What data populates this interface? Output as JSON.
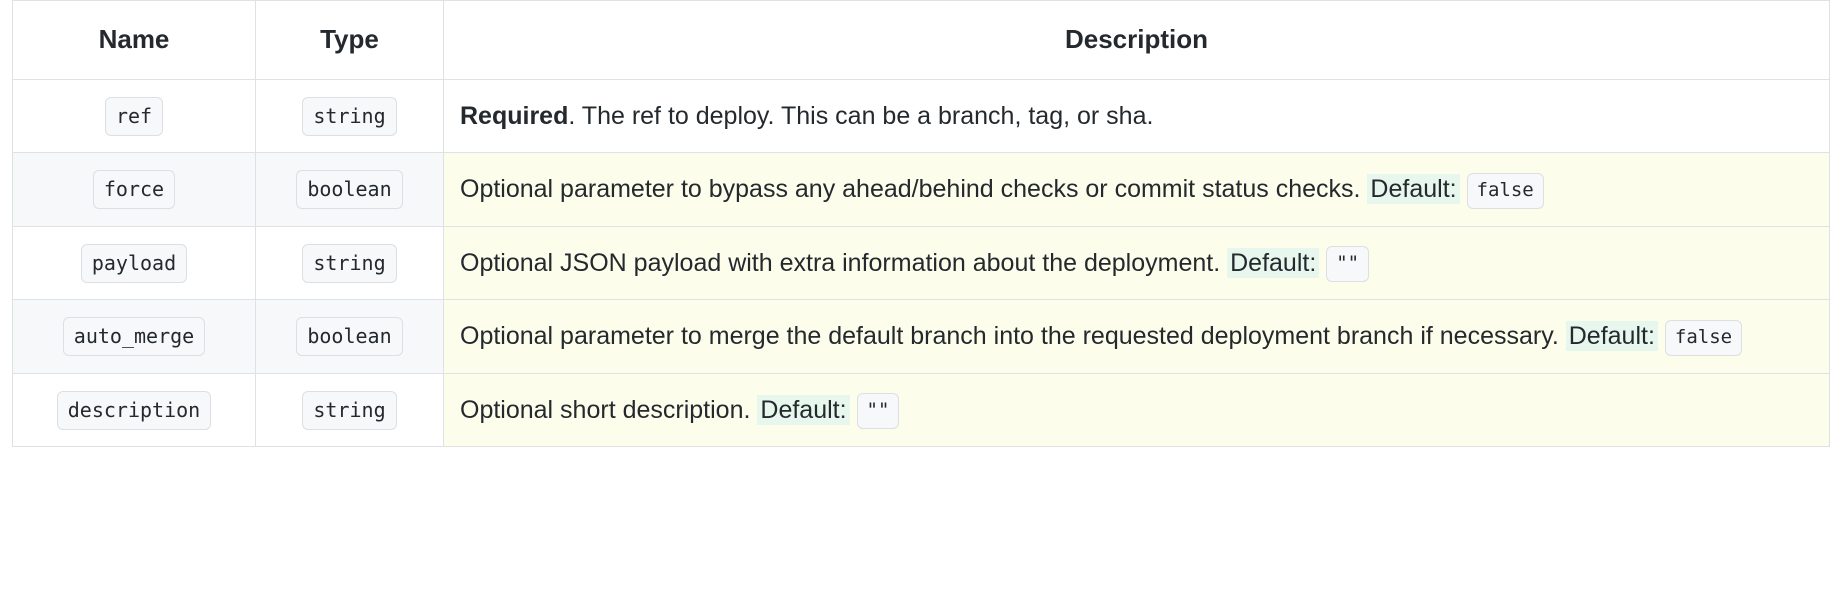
{
  "table": {
    "headers": {
      "name": "Name",
      "type": "Type",
      "description": "Description"
    },
    "rows": [
      {
        "name": "ref",
        "type": "string",
        "required_label": "Required",
        "desc_text": ". The ref to deploy. This can be a branch, tag, or sha.",
        "default_label": "",
        "default_value": "",
        "highlighted": false,
        "shaded": false
      },
      {
        "name": "force",
        "type": "boolean",
        "required_label": "",
        "desc_text": "Optional parameter to bypass any ahead/behind checks or commit status checks.",
        "default_label": "Default:",
        "default_value": "false",
        "highlighted": true,
        "shaded": true
      },
      {
        "name": "payload",
        "type": "string",
        "required_label": "",
        "desc_text": "Optional JSON payload with extra information about the deployment.",
        "default_label": "Default:",
        "default_value": "\"\"",
        "highlighted": true,
        "shaded": false
      },
      {
        "name": "auto_merge",
        "type": "boolean",
        "required_label": "",
        "desc_text": "Optional parameter to merge the default branch into the requested deployment branch if necessary.",
        "default_label": "Default:",
        "default_value": "false",
        "highlighted": true,
        "shaded": true
      },
      {
        "name": "description",
        "type": "string",
        "required_label": "",
        "desc_text": "Optional short description.",
        "default_label": "Default:",
        "default_value": "\"\"",
        "highlighted": true,
        "shaded": false
      }
    ]
  },
  "colors": {
    "border": "#dfe2e5",
    "row_shaded": "#f6f8fa",
    "desc_highlight": "#fdfdeb",
    "default_highlight": "#e8f7ee",
    "chip_background": "#f6f8fa",
    "text": "#24292e"
  }
}
